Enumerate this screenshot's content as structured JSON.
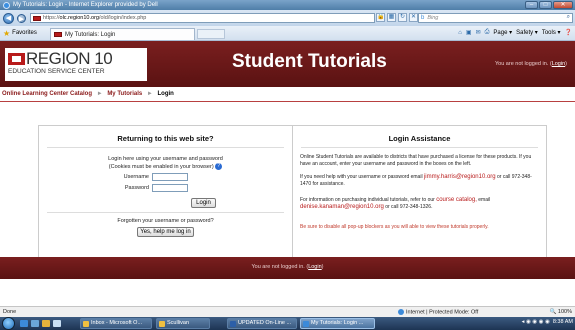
{
  "window": {
    "title": "My Tutorials: Login - Internet Explorer provided by Dell",
    "controls": {
      "minimize": "–",
      "maximize": "□",
      "close": "✕"
    }
  },
  "addressbar": {
    "url_prefix": "https://",
    "url_domain": "olc.region10.org",
    "url_path": "/old/login/index.php",
    "search_engine": "b",
    "search_placeholder": "Bing"
  },
  "favorites": {
    "label": "Favorites",
    "tab_title": "My Tutorials: Login",
    "command_bar": {
      "page": "Page ▾",
      "safety": "Safety ▾",
      "tools": "Tools ▾"
    }
  },
  "site": {
    "logo_name": "REGION 10",
    "logo_sub": "EDUCATION SERVICE CENTER",
    "title": "Student Tutorials",
    "login_state_prefix": "You are not logged in. (",
    "login_link": "Login",
    "login_state_suffix": ")"
  },
  "breadcrumb": {
    "items": [
      "Online Learning Center Catalog",
      "My Tutorials",
      "Login"
    ],
    "separator": "►"
  },
  "login_box": {
    "heading": "Returning to this web site?",
    "instructions_line1": "Login here using your username and password",
    "instructions_line2": "(Cookies must be enabled in your browser)",
    "help_icon": "?",
    "username_label": "Username",
    "password_label": "Password",
    "login_button": "Login",
    "forgot_text": "Forgotten your username or password?",
    "help_button": "Yes, help me log in"
  },
  "assistance": {
    "heading": "Login Assistance",
    "p1": "Online Student Tutorials are available to districts that have purchased a license for these products. If you have an account, enter your username and password in the boxes on the left.",
    "p2_pre": "If you need help with your username or password email",
    "p2_email": "jimmy.harris@region10.org",
    "p2_post": "or call 972-348-1470 for assistance.",
    "p3_pre": "For information on purchasing individual tutorials, refer to our",
    "p3_link": "course catalog,",
    "p3_mid": "email",
    "p3_email": "denise.kanaman@region10.org",
    "p3_post": "or call 972-348-1326.",
    "p4": "Be sure to disable all pop-up blockers as you will able to view these tutorials properly."
  },
  "footer": {
    "prefix": "You are not logged in. (",
    "link": "Login",
    "suffix": ")"
  },
  "statusbar": {
    "left": "Done",
    "zone": "Internet | Protected Mode: Off",
    "zoom": "100%"
  },
  "taskbar": {
    "buttons": [
      "Inbox - Microsoft O...",
      "Scullivan",
      "UPDATED On-Line ...",
      "My Tutorials: Login ..."
    ],
    "clock": "8:38 AM"
  },
  "colors": {
    "brand_maroon": "#6b1a1a",
    "brand_red": "#b81b1b",
    "link_red": "#8b1a1a"
  }
}
